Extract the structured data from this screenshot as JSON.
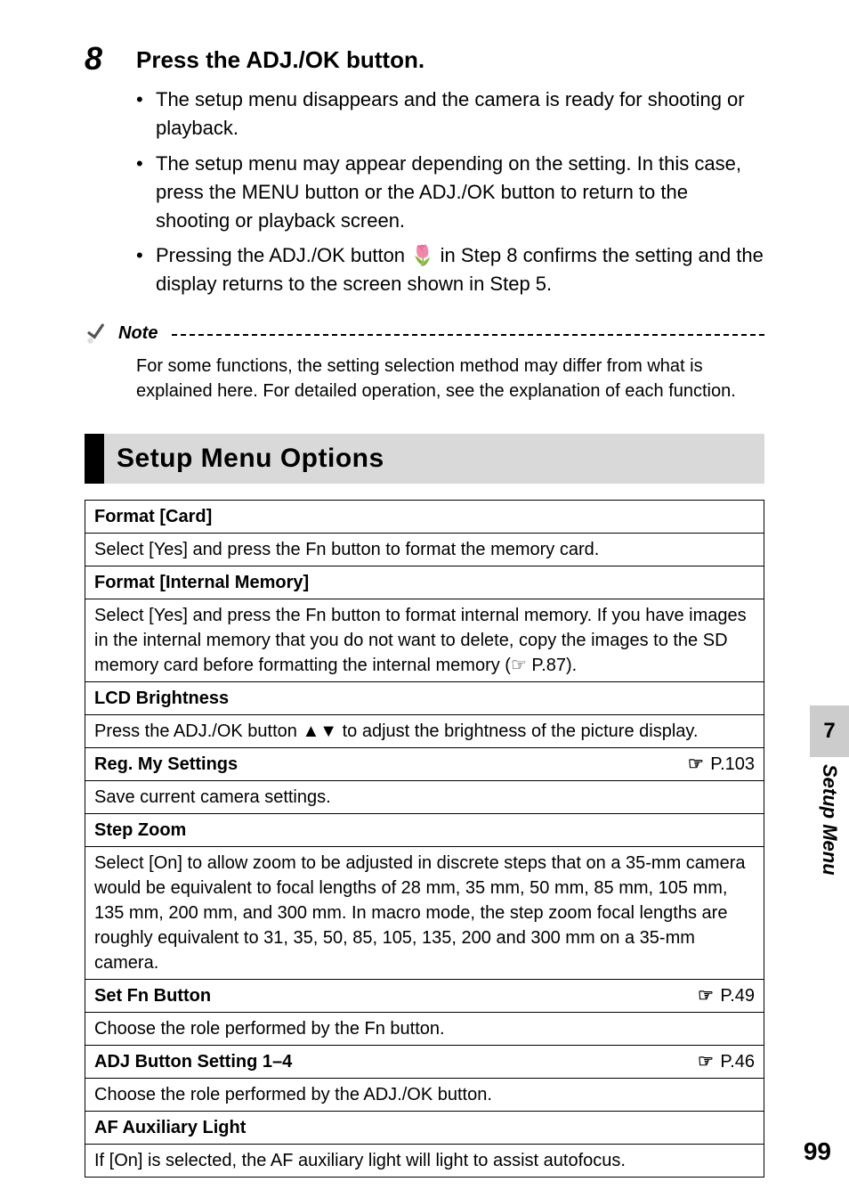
{
  "step": {
    "number": "8",
    "title": "Press the ADJ./OK button.",
    "bullets": [
      "The setup menu disappears and the camera is ready for shooting or playback.",
      "The setup menu may appear depending on the setting. In this case, press the MENU button or the ADJ./OK button to return to the shooting or playback screen.",
      "Pressing the ADJ./OK button 🌷 in Step 8 confirms the setting and the display returns to the screen shown in Step 5."
    ]
  },
  "note": {
    "label": "Note",
    "text": "For some functions, the setting selection method may differ from what is explained here. For detailed operation, see the explanation of each function."
  },
  "section_title": "Setup Menu Options",
  "hand_glyph": "☞",
  "rows": [
    {
      "title": "Format [Card]",
      "ref": "",
      "desc": "Select [Yes] and press the Fn button to format the memory card."
    },
    {
      "title": "Format [Internal Memory]",
      "ref": "",
      "desc": "Select [Yes] and press the Fn button to format internal memory. If you have images in the internal memory that you do not want to delete, copy the images to the SD memory card before formatting the internal memory (☞ P.87)."
    },
    {
      "title": "LCD Brightness",
      "ref": "",
      "desc": "Press the ADJ./OK button ▲▼ to adjust the brightness of the picture display."
    },
    {
      "title": "Reg. My Settings",
      "ref": "P.103",
      "desc": "Save current camera settings."
    },
    {
      "title": "Step Zoom",
      "ref": "",
      "desc": "Select [On] to allow zoom to be adjusted in discrete steps that on a 35-mm camera would be equivalent to focal lengths of 28 mm, 35 mm, 50 mm, 85 mm, 105 mm, 135 mm, 200 mm, and 300 mm. In macro mode, the step zoom focal lengths are roughly equivalent to 31, 35, 50, 85, 105, 135, 200 and 300 mm on a 35-mm camera."
    },
    {
      "title": "Set Fn Button",
      "ref": "P.49",
      "desc": "Choose the role performed by the Fn button."
    },
    {
      "title": "ADJ Button Setting 1–4",
      "ref": "P.46",
      "desc": "Choose the role performed by the ADJ./OK button."
    },
    {
      "title": "AF Auxiliary Light",
      "ref": "",
      "desc": "If [On] is selected, the AF auxiliary light will light to assist autofocus."
    }
  ],
  "side": {
    "number": "7",
    "label": "Setup Menu"
  },
  "page_number": "99"
}
